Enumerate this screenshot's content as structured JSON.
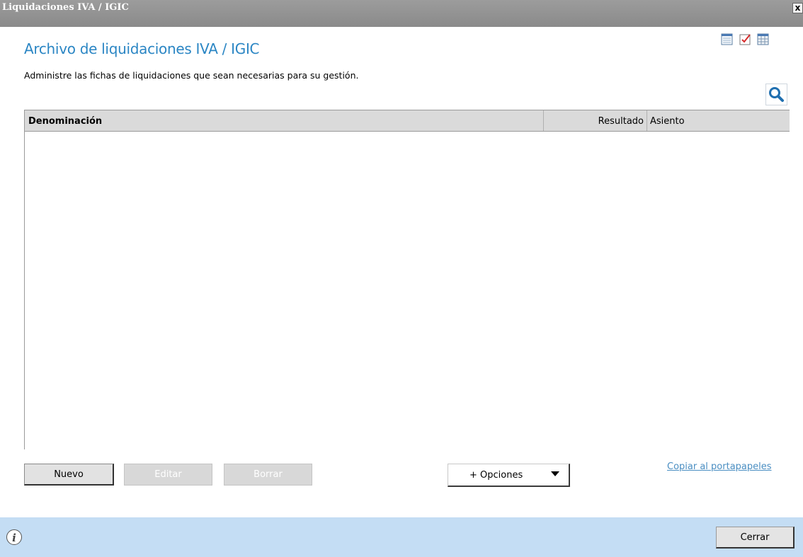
{
  "window": {
    "title": "Liquidaciones IVA / IGIC",
    "close_label": "x"
  },
  "header": {
    "title": "Archivo de liquidaciones IVA / IGIC",
    "subtitle": "Administre las fichas de liquidaciones que sean necesarias para su gestión."
  },
  "toolbar_icons": [
    "calendar-icon",
    "checklist-icon",
    "grid-calendar-icon"
  ],
  "search_icon": "magnifier-icon",
  "table": {
    "columns": [
      "Denominación",
      "Resultado",
      "Asiento"
    ],
    "rows": []
  },
  "buttons": {
    "new": "Nuevo",
    "edit": "Editar",
    "delete": "Borrar",
    "options": "+ Opciones",
    "copy_clipboard": "Copiar al portapapeles",
    "close": "Cerrar"
  },
  "colors": {
    "accent": "#2b86c4",
    "footer": "#c4ddf4",
    "titlebar": "#8f8f8f"
  }
}
